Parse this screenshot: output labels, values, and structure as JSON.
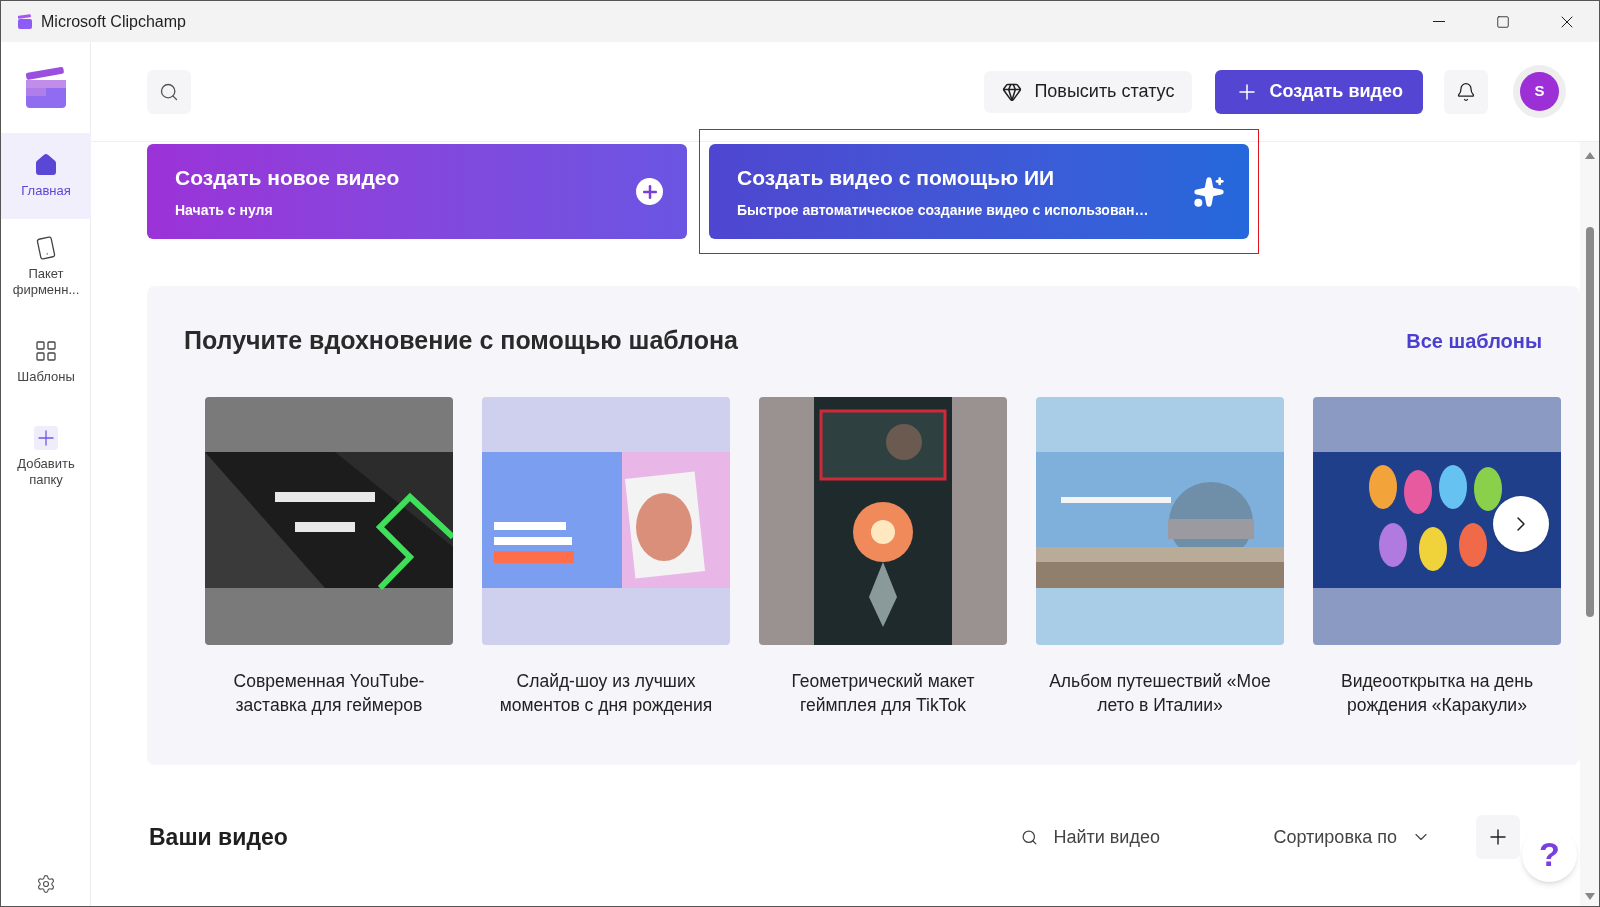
{
  "window": {
    "title": "Microsoft Clipchamp"
  },
  "sidebar": {
    "items": [
      {
        "label": "Главная",
        "kind": "home",
        "selected": true
      },
      {
        "label": "Пакет фирменн...",
        "kind": "brand",
        "selected": false
      },
      {
        "label": "Шаблоны",
        "kind": "templates",
        "selected": false
      },
      {
        "label": "Добавить папку",
        "kind": "add",
        "selected": false
      }
    ]
  },
  "header": {
    "upgrade_button": "Повысить статус",
    "create_button": "Создать видео",
    "avatar": "S"
  },
  "create_cards": [
    {
      "title": "Создать новое видео",
      "subtitle": "Начать с нуля",
      "kind": "blank",
      "highlighted": false
    },
    {
      "title": "Создать видео с помощью ИИ",
      "subtitle": "Быстрое автоматическое создание видео с использован…",
      "kind": "ai",
      "highlighted": true
    }
  ],
  "templates": {
    "title": "Получите вдохновение с помощью шаблона",
    "all_link": "Все шаблоны",
    "items": [
      {
        "caption": "Современная YouTube-заставка для геймеров",
        "kind": "picture"
      },
      {
        "caption": "Слайд-шоу из лучших моментов с дня рождения",
        "kind": "picture"
      },
      {
        "caption": "Геометрический макет геймплея для TikTok",
        "kind": "picture"
      },
      {
        "caption": "Альбом путешествий «Мое лето в Италии»",
        "kind": "picture"
      },
      {
        "caption": "Видеооткрытка на день рождения «Каракули»",
        "kind": "picture"
      }
    ]
  },
  "your_videos": {
    "title": "Ваши видео",
    "search_placeholder": "Найти видео",
    "sort_label": "Сортировка по"
  },
  "help_button": "?"
}
